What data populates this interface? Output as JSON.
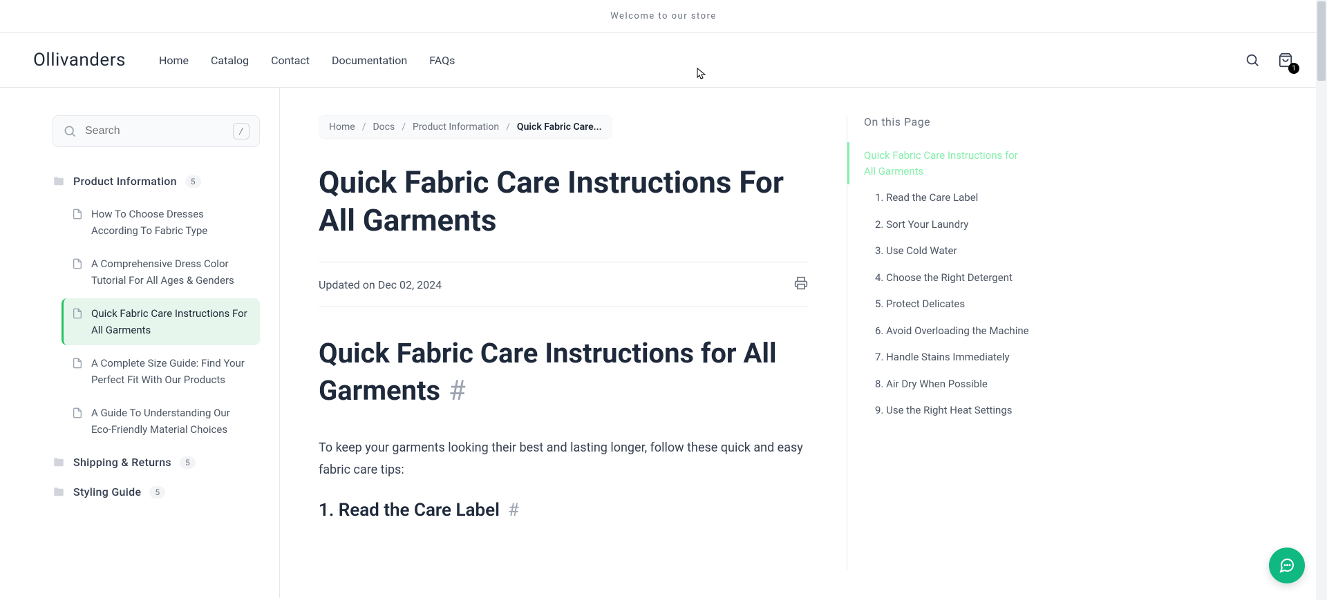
{
  "announcement": "Welcome to our store",
  "brand": "Ollivanders",
  "nav": [
    "Home",
    "Catalog",
    "Contact",
    "Documentation",
    "FAQs"
  ],
  "cart_count": "1",
  "search": {
    "placeholder": "Search",
    "kbd": "/"
  },
  "sidebar": {
    "sections": [
      {
        "title": "Product Information",
        "count": "5",
        "items": [
          {
            "label": "How To Choose Dresses According To Fabric Type",
            "active": false
          },
          {
            "label": "A Comprehensive Dress Color Tutorial For All Ages & Genders",
            "active": false
          },
          {
            "label": "Quick Fabric Care Instructions For All Garments",
            "active": true
          },
          {
            "label": "A Complete Size Guide: Find Your Perfect Fit With Our Products",
            "active": false
          },
          {
            "label": "A Guide To Understanding Our Eco-Friendly Material Choices",
            "active": false
          }
        ]
      },
      {
        "title": "Shipping & Returns",
        "count": "5",
        "items": []
      },
      {
        "title": "Styling Guide",
        "count": "5",
        "items": []
      }
    ]
  },
  "breadcrumbs": [
    "Home",
    "Docs",
    "Product Information",
    "Quick Fabric Care..."
  ],
  "article": {
    "title": "Quick Fabric Care Instructions For All Garments",
    "updated": "Updated on Dec 02, 2024",
    "h2": "Quick Fabric Care Instructions for All Garments",
    "intro": "To keep your garments looking their best and lasting longer, follow these quick and easy fabric care tips:",
    "h3": "1. Read the Care Label"
  },
  "toc": {
    "title": "On this Page",
    "items": [
      {
        "label": "Quick Fabric Care Instructions for All Garments",
        "active": true,
        "sub": false
      },
      {
        "label": "1. Read the Care Label",
        "active": false,
        "sub": true
      },
      {
        "label": "2. Sort Your Laundry",
        "active": false,
        "sub": true
      },
      {
        "label": "3. Use Cold Water",
        "active": false,
        "sub": true
      },
      {
        "label": "4. Choose the Right Detergent",
        "active": false,
        "sub": true
      },
      {
        "label": "5. Protect Delicates",
        "active": false,
        "sub": true
      },
      {
        "label": "6. Avoid Overloading the Machine",
        "active": false,
        "sub": true
      },
      {
        "label": "7. Handle Stains Immediately",
        "active": false,
        "sub": true
      },
      {
        "label": "8. Air Dry When Possible",
        "active": false,
        "sub": true
      },
      {
        "label": "9. Use the Right Heat Settings",
        "active": false,
        "sub": true
      }
    ]
  }
}
